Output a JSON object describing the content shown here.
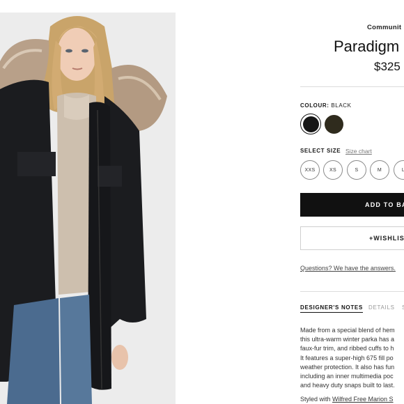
{
  "product": {
    "brand": "Communit",
    "name": "Paradigm",
    "price": "$325",
    "colour_label": "COLOUR:",
    "colour_value": "BLACK",
    "colours": [
      {
        "name": "Black",
        "hex": "#151515",
        "selected": true
      },
      {
        "name": "Olive",
        "hex": "#2f2b1d",
        "selected": false
      }
    ],
    "size_label": "SELECT SIZE",
    "size_chart": "Size chart",
    "sizes": [
      "XXS",
      "XS",
      "S",
      "M",
      "L"
    ],
    "add_to_bag": "ADD TO BA",
    "wishlist": "+WISHLIS",
    "questions": "Questions? We have the answers."
  },
  "tabs": [
    {
      "label": "DESIGNER'S NOTES",
      "active": true
    },
    {
      "label": "DETAILS",
      "active": false
    },
    {
      "label": "S",
      "active": false
    }
  ],
  "description": {
    "lines": [
      "Made from a special blend of hem",
      "this ultra-warm winter parka has a",
      "faux-fur trim, and ribbed cuffs to h",
      "It features a super-high 675 fill po",
      "weather protection. It also has fun",
      "including an inner multimedia poc",
      "and heavy duty snaps built to last."
    ],
    "styled_prefix": "Styled with ",
    "styled_link": "Wilfred Free Marion S"
  },
  "colors": {
    "accent": "#111111",
    "photo_bg": "#ededed"
  }
}
